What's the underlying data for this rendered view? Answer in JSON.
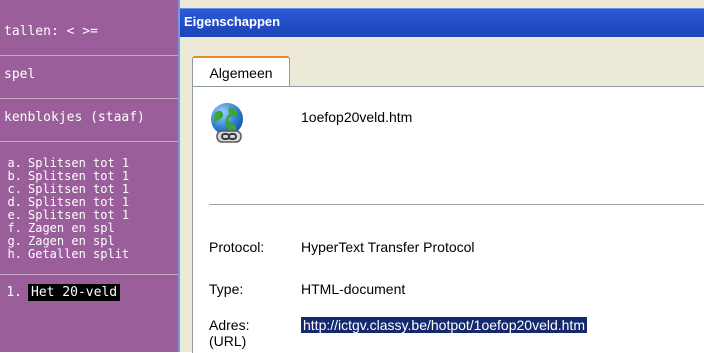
{
  "left_menu": {
    "item1": "tallen: < >=",
    "item2": "spel",
    "item3": "kenblokjes (staaf)",
    "subitems": [
      {
        "letter": "a.",
        "text": "Splitsen tot 1"
      },
      {
        "letter": "b.",
        "text": "Splitsen tot 1"
      },
      {
        "letter": "c.",
        "text": "Splitsen tot 1"
      },
      {
        "letter": "d.",
        "text": "Splitsen tot 1"
      },
      {
        "letter": "e.",
        "text": "Splitsen tot 1"
      },
      {
        "letter": "f.",
        "text": "Zagen en spl"
      },
      {
        "letter": "g.",
        "text": "Zagen en spl"
      },
      {
        "letter": "h.",
        "text": "Getallen split"
      }
    ],
    "numbered": {
      "number": "1.",
      "text": "Het 20-veld"
    }
  },
  "dialog": {
    "title": "Eigenschappen",
    "tab": "Algemeen",
    "filename": "1oefop20veld.htm",
    "icon": "globe-link-icon",
    "properties": {
      "protocol_label": "Protocol:",
      "protocol_value": "HyperText Transfer Protocol",
      "type_label": "Type:",
      "type_value": "HTML-document",
      "address_label": "Adres:",
      "address_label_2": "(URL)",
      "address_value": "http://ictgv.classy.be/hotpot/1oefop20veld.htm"
    }
  }
}
